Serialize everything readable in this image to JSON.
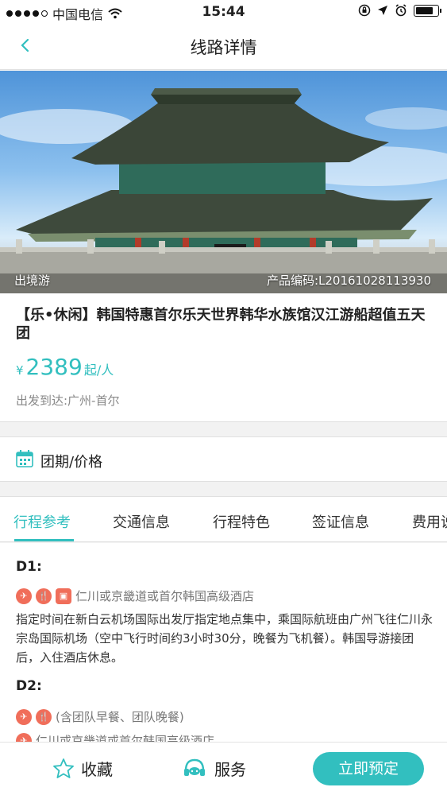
{
  "status_bar": {
    "carrier": "中国电信",
    "time": "15:44",
    "battery_level": 0.85
  },
  "nav": {
    "title": "线路详情",
    "back_icon": "chevron-left-icon"
  },
  "hero": {
    "tag": "出境游",
    "product_code": "产品编码:L20161028113930"
  },
  "product": {
    "name": "【乐•休闲】韩国特惠首尔乐天世界韩华水族馆汉江游船超值五天团",
    "currency": "¥",
    "price": "2389",
    "price_unit": "起/人",
    "route": "出发到达:广州-首尔"
  },
  "tour_dates": {
    "label": "团期/价格",
    "icon": "calendar-icon"
  },
  "tabs": [
    {
      "label": "行程参考",
      "active": true
    },
    {
      "label": "交通信息",
      "active": false
    },
    {
      "label": "行程特色",
      "active": false
    },
    {
      "label": "签证信息",
      "active": false
    },
    {
      "label": "费用说",
      "active": false
    }
  ],
  "itinerary": [
    {
      "day": "D1:",
      "hotel": "仁川或京畿道或首尔韩国高级酒店",
      "description": "指定时间在新白云机场国际出发厅指定地点集中，乘国际航班由广州飞往仁川永宗岛国际机场（空中飞行时间约3小时30分，晚餐为飞机餐）。韩国导游接团后，入住酒店休息。"
    },
    {
      "day": "D2:",
      "meals": "(含团队早餐、团队晚餐)",
      "hotel": "仁川或京畿道或首尔韩国高级酒店"
    }
  ],
  "bottom_bar": {
    "favorite": "收藏",
    "service": "服务",
    "book": "立即预定"
  },
  "colors": {
    "accent": "#32bfbf",
    "icon_red": "#f06e5a"
  }
}
